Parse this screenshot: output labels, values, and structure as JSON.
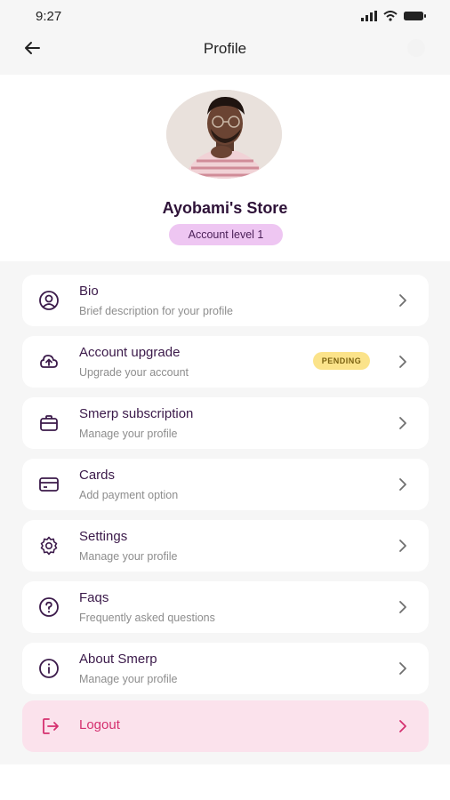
{
  "status_bar": {
    "time": "9:27"
  },
  "nav": {
    "title": "Profile"
  },
  "profile": {
    "name": "Ayobami's Store",
    "level": "Account level 1"
  },
  "menu": [
    {
      "title": "Bio",
      "subtitle": "Brief description for your profile",
      "icon": "user-circle-icon"
    },
    {
      "title": "Account upgrade",
      "subtitle": "Upgrade your account",
      "icon": "cloud-upload-icon",
      "badge": "PENDING"
    },
    {
      "title": "Smerp subscription",
      "subtitle": "Manage your profile",
      "icon": "briefcase-icon"
    },
    {
      "title": "Cards",
      "subtitle": "Add payment option",
      "icon": "credit-card-icon"
    },
    {
      "title": "Settings",
      "subtitle": "Manage your profile",
      "icon": "gear-icon"
    },
    {
      "title": "Faqs",
      "subtitle": "Frequently asked questions",
      "icon": "question-circle-icon"
    },
    {
      "title": "About Smerp",
      "subtitle": "Manage your profile",
      "icon": "info-circle-icon"
    }
  ],
  "logout": {
    "label": "Logout",
    "icon": "logout-icon"
  },
  "colors": {
    "primary": "#3b1a4a",
    "badge_bg": "#eec6f2",
    "pending_bg": "#fbe38a",
    "logout_bg": "#fbe2ec",
    "logout_text": "#d5306f"
  }
}
